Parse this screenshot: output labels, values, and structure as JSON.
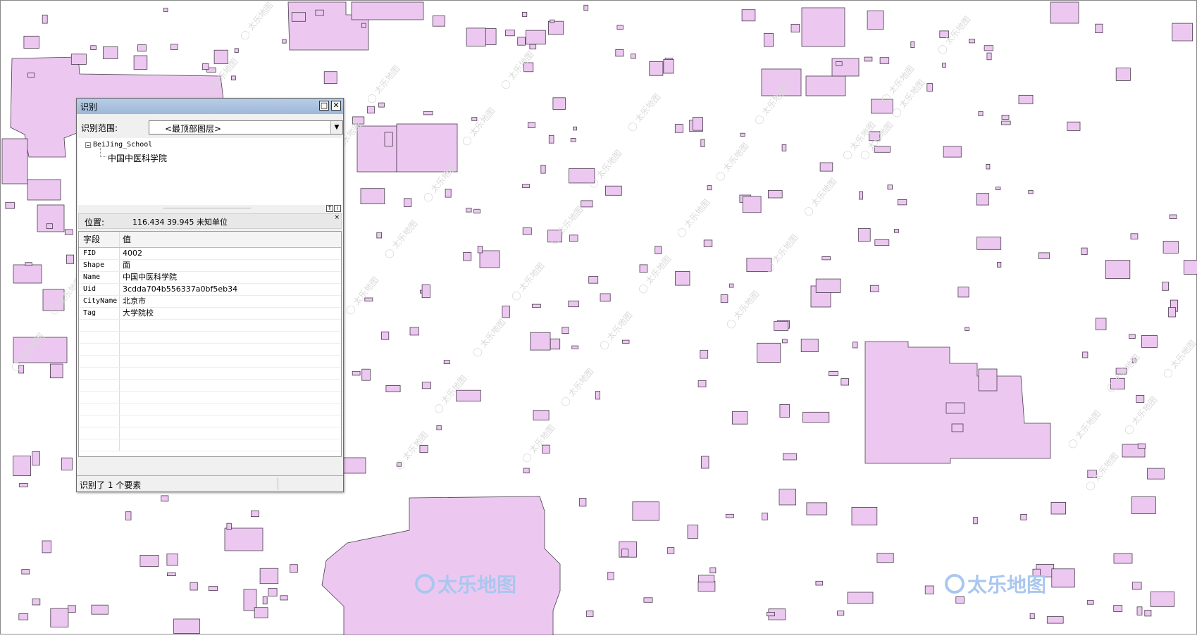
{
  "map": {
    "fill_color": "#ecc8f0",
    "stroke_color": "#4a3c4e",
    "watermark_small": "太乐地图",
    "watermark_big": "太乐地图",
    "watermark_big_color": "#a9c7ef"
  },
  "identify": {
    "title": "识别",
    "scope_label": "识别范围:",
    "scope_value": "<最顶部图层>",
    "tree_layer": "BeiJing_School",
    "tree_feature": "中国中医科学院",
    "location_label": "位置:",
    "location_value": "116.434  39.945 未知单位",
    "column_field": "字段",
    "column_value": "值",
    "rows": [
      {
        "field": "FID",
        "value": "4002"
      },
      {
        "field": "Shape",
        "value": "面"
      },
      {
        "field": "Name",
        "value": "中国中医科学院"
      },
      {
        "field": "Uid",
        "value": "3cdda704b556337a0bf5eb34"
      },
      {
        "field": "CityName",
        "value": "北京市"
      },
      {
        "field": "Tag",
        "value": "大学院校"
      }
    ],
    "status": "识别了 1 个要素"
  }
}
